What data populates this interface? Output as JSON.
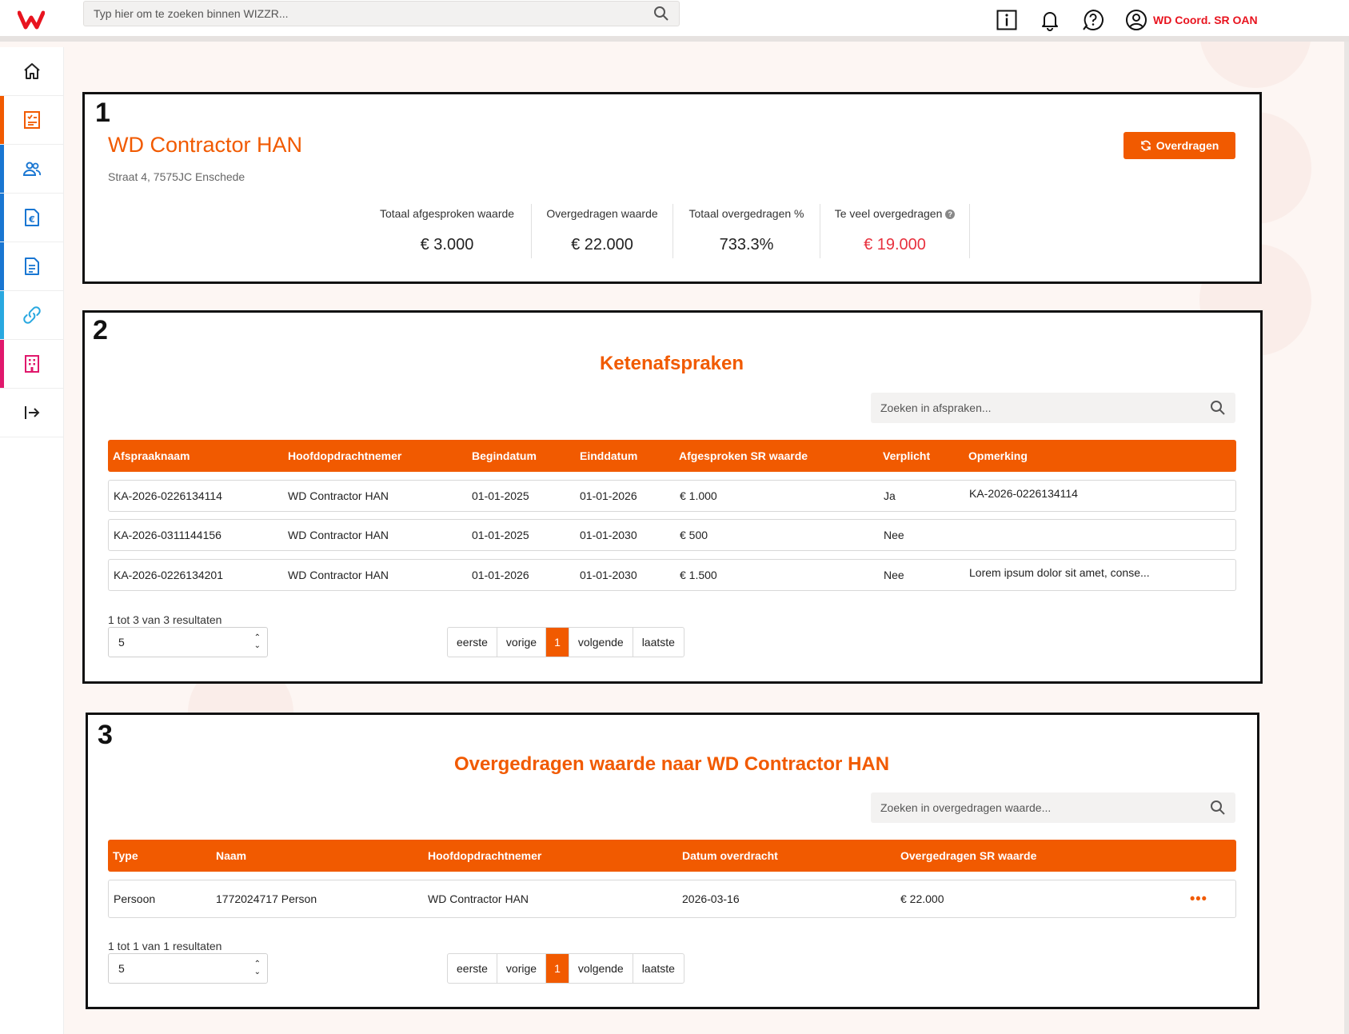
{
  "header": {
    "search_placeholder": "Typ hier om te zoeken binnen WIZZR...",
    "user_name": "WD Coord. SR OAN",
    "brand_color": "#f15a00",
    "user_color": "#e8141f",
    "icons": [
      "info-icon",
      "bell-icon",
      "help-icon",
      "user-icon"
    ]
  },
  "sidebar": {
    "items": [
      {
        "icon": "home-icon",
        "color": "#222222"
      },
      {
        "icon": "checklist-icon",
        "color": "#f15a00"
      },
      {
        "icon": "users-icon",
        "color": "#1976d2"
      },
      {
        "icon": "euro-document-icon",
        "color": "#1976d2"
      },
      {
        "icon": "document-icon",
        "color": "#1976d2"
      },
      {
        "icon": "link-icon",
        "color": "#29a8e0"
      },
      {
        "icon": "building-icon",
        "color": "#e0186c"
      },
      {
        "icon": "logout-icon",
        "color": "#222222"
      }
    ]
  },
  "panels": {
    "one": {
      "number": "1"
    },
    "two": {
      "number": "2"
    },
    "three": {
      "number": "3"
    }
  },
  "company": {
    "name": "WD Contractor HAN",
    "address": "Straat 4, 7575JC Enschede",
    "transfer_button": "Overdragen"
  },
  "stats": [
    {
      "label": "Totaal afgesproken waarde",
      "value": "€ 3.000"
    },
    {
      "label": "Overgedragen waarde",
      "value": "€ 22.000"
    },
    {
      "label": "Totaal overgedragen %",
      "value": "733.3%"
    },
    {
      "label": "Te veel overgedragen",
      "value": "€ 19.000",
      "help": "?"
    }
  ],
  "agreements": {
    "title": "Ketenafspraken",
    "search_placeholder": "Zoeken in afspraken...",
    "columns": [
      "Afspraaknaam",
      "Hoofdopdrachtnemer",
      "Begindatum",
      "Einddatum",
      "Afgesproken SR waarde",
      "Verplicht",
      "Opmerking"
    ],
    "rows": [
      [
        "KA-2026-0226134114",
        "WD Contractor HAN",
        "01-01-2025",
        "01-01-2026",
        "€ 1.000",
        "Ja",
        "KA-2026-0226134114"
      ],
      [
        "KA-2026-0311144156",
        "WD Contractor HAN",
        "01-01-2025",
        "01-01-2030",
        "€ 500",
        "Nee",
        ""
      ],
      [
        "KA-2026-0226134201",
        "WD Contractor HAN",
        "01-01-2026",
        "01-01-2030",
        "€ 1.500",
        "Nee",
        "Lorem ipsum dolor sit amet, conse..."
      ]
    ],
    "results": "1 tot 3 van 3 resultaten",
    "page_size": "5",
    "pager": {
      "first": "eerste",
      "prev": "vorige",
      "current": "1",
      "next": "volgende",
      "last": "laatste"
    }
  },
  "transfers": {
    "title": "Overgedragen waarde naar WD Contractor HAN",
    "search_placeholder": "Zoeken in overgedragen waarde...",
    "columns": [
      "Type",
      "Naam",
      "Hoofdopdrachtnemer",
      "Datum overdracht",
      "Overgedragen SR waarde"
    ],
    "rows": [
      [
        "Persoon",
        "1772024717 Person",
        "WD Contractor HAN",
        "2026-03-16",
        "€ 22.000",
        "•••"
      ]
    ],
    "results": "1 tot 1 van 1 resultaten",
    "page_size": "5",
    "pager": {
      "first": "eerste",
      "prev": "vorige",
      "current": "1",
      "next": "volgende",
      "last": "laatste"
    }
  }
}
